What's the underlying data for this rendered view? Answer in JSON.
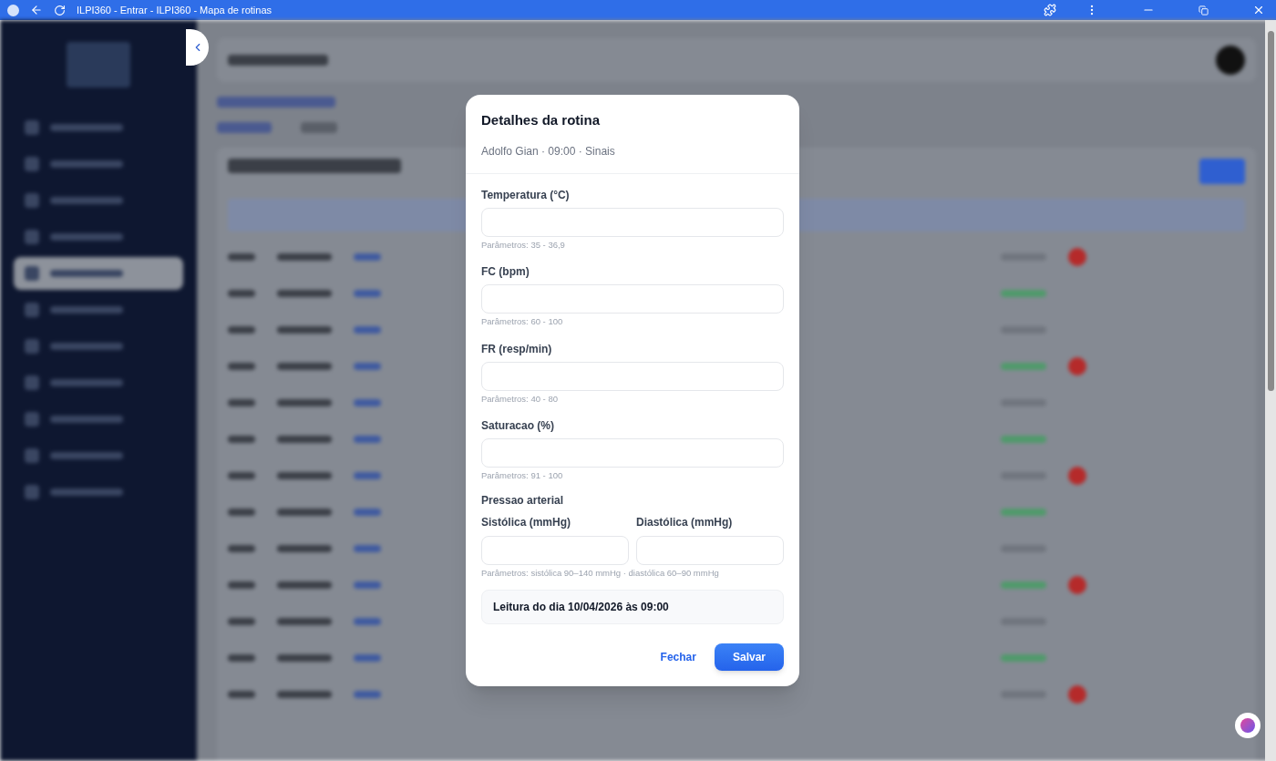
{
  "browser": {
    "title": "ILPI360 - Entrar - ILPI360 - Mapa de rotinas"
  },
  "modal": {
    "title": "Detalhes da rotina",
    "subtitle": "Adolfo Gian · 09:00 · Sinais",
    "fields": [
      {
        "label": "Temperatura (°C)",
        "hint": "Parâmetros: 35 - 36,9"
      },
      {
        "label": "FC (bpm)",
        "hint": "Parâmetros: 60 - 100"
      },
      {
        "label": "FR (resp/min)",
        "hint": "Parâmetros: 40 - 80"
      },
      {
        "label": "Saturacao (%)",
        "hint": "Parâmetros: 91 - 100"
      }
    ],
    "blood_pressure": {
      "label": "Pressao arterial",
      "fields": [
        {
          "label": "Sistólica (mmHg)"
        },
        {
          "label": "Diastólica (mmHg)"
        }
      ],
      "hint": "Parâmetros: sistólica 90–140 mmHg · diastólica 60–90 mmHg"
    },
    "reading_note": "Leitura do dia 10/04/2026 às 09:00",
    "buttons": [
      {
        "label": "Fechar",
        "kind": "text"
      },
      {
        "label": "Salvar",
        "kind": "primary"
      }
    ]
  }
}
